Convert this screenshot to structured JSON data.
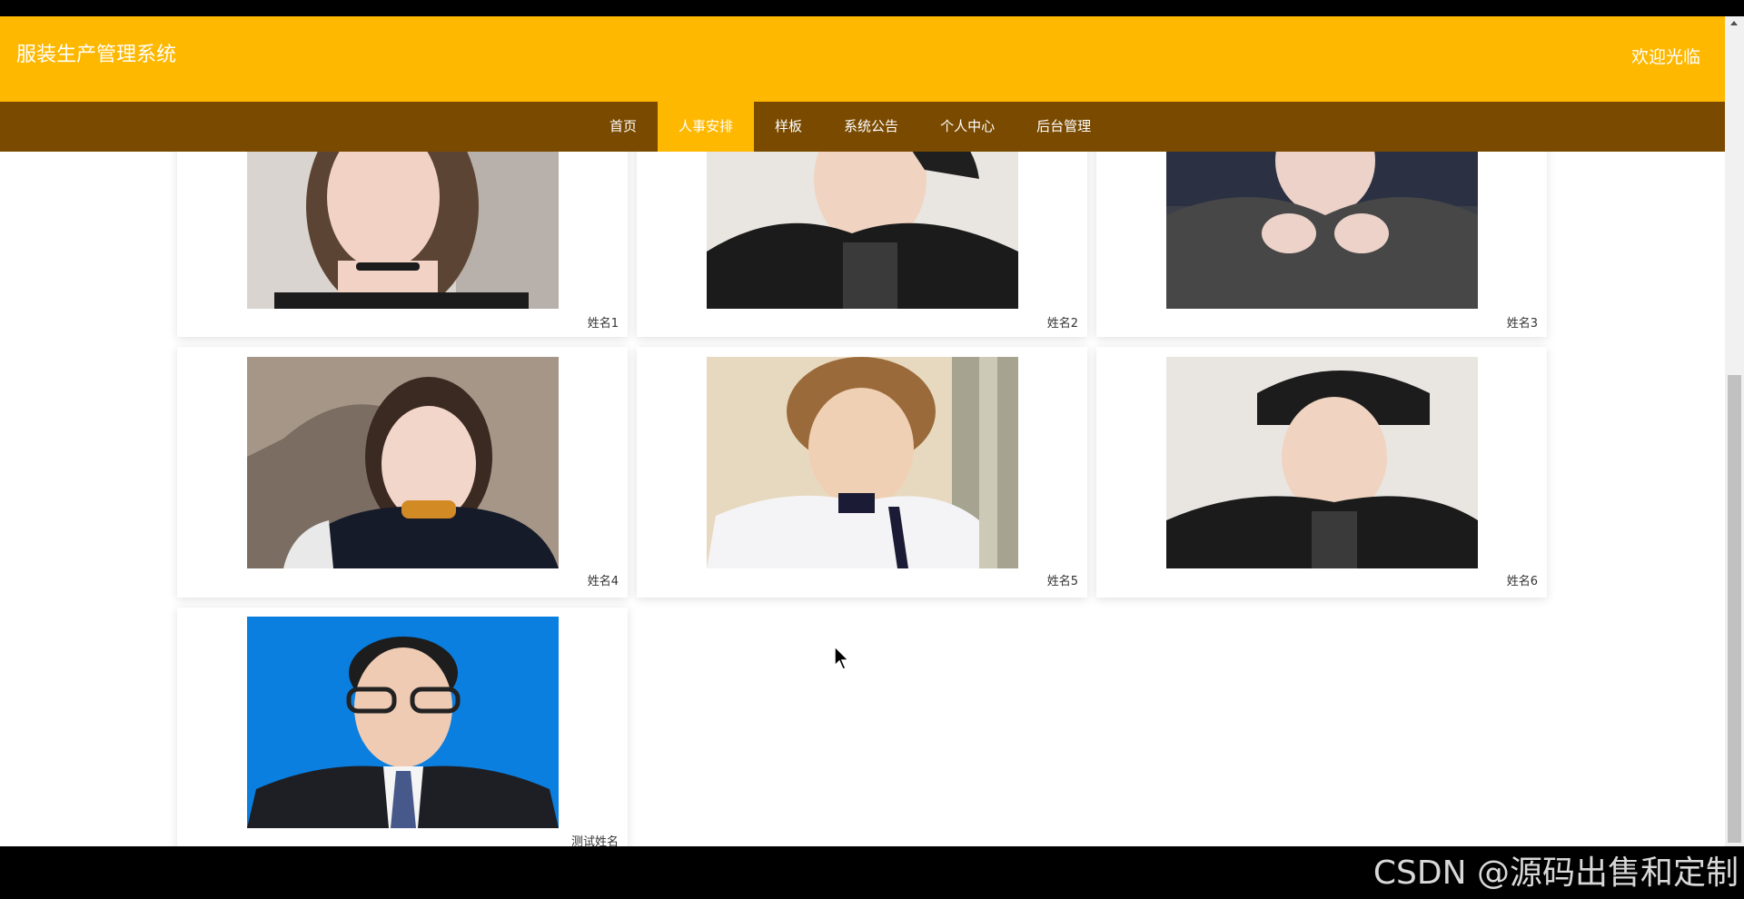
{
  "header": {
    "site_title": "服装生产管理系统",
    "welcome": "欢迎光临"
  },
  "nav": {
    "items": [
      {
        "label": "首页"
      },
      {
        "label": "人事安排"
      },
      {
        "label": "样板"
      },
      {
        "label": "系统公告"
      },
      {
        "label": "个人中心"
      },
      {
        "label": "后台管理"
      }
    ],
    "active_index": 1
  },
  "staff": [
    {
      "name": "姓名1"
    },
    {
      "name": "姓名2"
    },
    {
      "name": "姓名3"
    },
    {
      "name": "姓名4"
    },
    {
      "name": "姓名5"
    },
    {
      "name": "姓名6"
    },
    {
      "name": "测试姓名"
    }
  ],
  "watermark": "CSDN @源码出售和定制",
  "colors": {
    "header_bg": "#ffb800",
    "nav_bg": "#7a4a00",
    "nav_active_bg": "#ffb800"
  }
}
